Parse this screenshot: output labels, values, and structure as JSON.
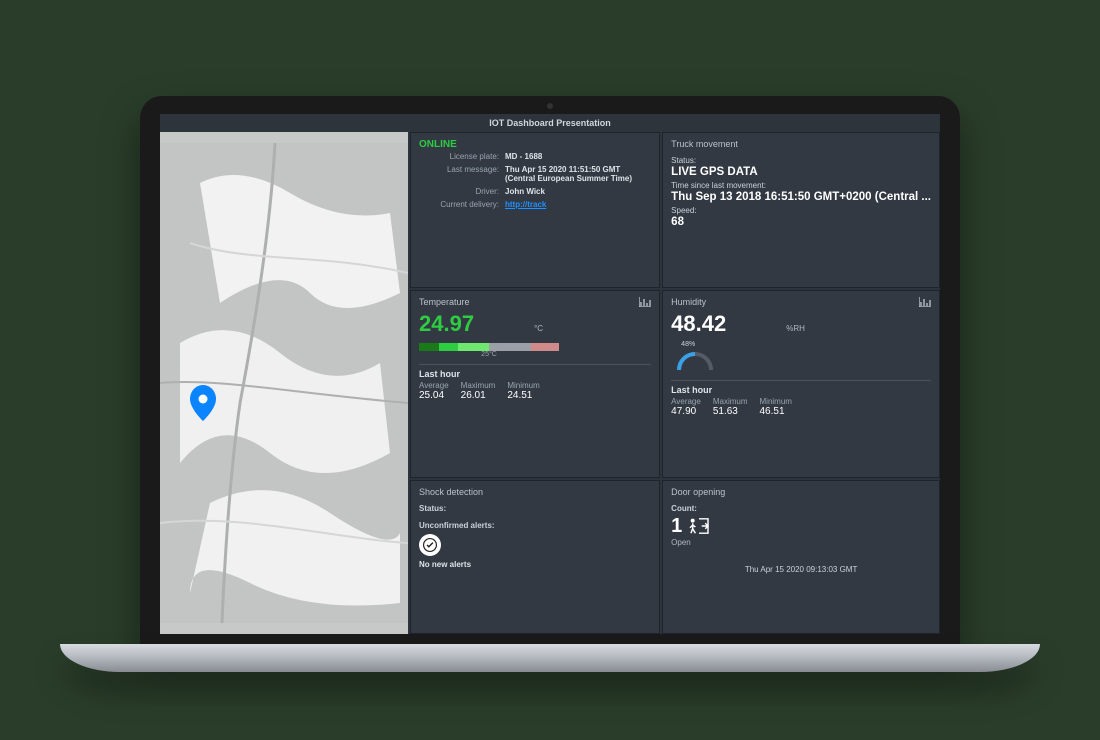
{
  "title": "IOT Dashboard Presentation",
  "info": {
    "status": "ONLINE",
    "license_label": "License plate:",
    "license": "MD - 1688",
    "lastmsg_label": "Last message:",
    "lastmsg": "Thu Apr 15 2020 11:51:50 GMT (Central European Summer Time)",
    "driver_label": "Driver:",
    "driver": "John Wick",
    "delivery_label": "Current delivery:",
    "delivery_link": "http://track"
  },
  "movement": {
    "title": "Truck movement",
    "status_label": "Status:",
    "status": "LIVE GPS DATA",
    "time_label": "Time since last movement:",
    "time": "Thu Sep 13 2018 16:51:50 GMT+0200 (Central ...",
    "speed_label": "Speed:",
    "speed": "68"
  },
  "temperature": {
    "title": "Temperature",
    "value": "24.97",
    "unit": "°C",
    "scale": "25°C",
    "lasthour": "Last hour",
    "avg_label": "Average",
    "avg": "25.04",
    "max_label": "Maximum",
    "max": "26.01",
    "min_label": "Minimum",
    "min": "24.51",
    "color": "#2ecc40"
  },
  "humidity": {
    "title": "Humidity",
    "value": "48.42",
    "unit": "%RH",
    "gauge": "48%",
    "lasthour": "Last hour",
    "avg_label": "Average",
    "avg": "47.90",
    "max_label": "Maximum",
    "max": "51.63",
    "min_label": "Minimum",
    "min": "46.51"
  },
  "shock": {
    "title": "Shock detection",
    "status_label": "Status:",
    "unconfirmed": "Unconfirmed alerts:",
    "noalerts": "No new alerts"
  },
  "door": {
    "title": "Door opening",
    "count_label": "Count:",
    "count": "1",
    "state": "Open",
    "timestamp": "Thu Apr 15 2020 09:13:03 GMT"
  }
}
